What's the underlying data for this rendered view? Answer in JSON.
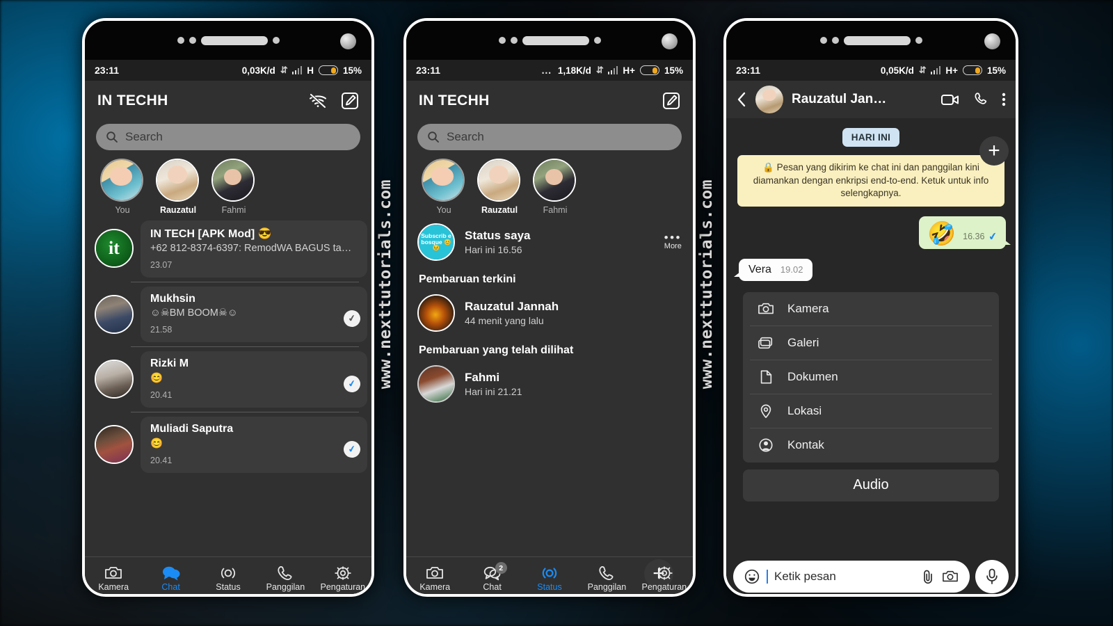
{
  "watermark": {
    "text": "www.nexttutorials.com"
  },
  "phone1": {
    "statusbar": {
      "time": "23:11",
      "speed": "0,03K/d",
      "network": "H",
      "battery": "15%"
    },
    "appbar": {
      "title": "IN TECHH",
      "wifi_icon": "wifi-off-icon",
      "compose_icon": "compose-icon"
    },
    "search": {
      "placeholder": "Search",
      "icon": "search-icon"
    },
    "stories": [
      {
        "label": "You",
        "state": "seen"
      },
      {
        "label": "Rauzatul",
        "state": "active"
      },
      {
        "label": "Fahmi",
        "state": "unseen"
      }
    ],
    "chats": [
      {
        "name": "IN TECH [APK Mod] 😎",
        "message": "+62 812-8374-6397: RemodWA BAGUS  ta…",
        "time": "23.07",
        "tick": "none"
      },
      {
        "name": "Mukhsin",
        "message": "☺☠BM BOOM☠☺",
        "time": "21.58",
        "tick": "grey"
      },
      {
        "name": "Rizki M",
        "message": "😊",
        "time": "20.41",
        "tick": "blue"
      },
      {
        "name": "Muliadi Saputra",
        "message": "😊",
        "time": "20.41",
        "tick": "blue"
      }
    ],
    "nav": [
      {
        "label": "Kamera",
        "icon": "camera-icon",
        "active": false
      },
      {
        "label": "Chat",
        "icon": "chat-icon",
        "active": true
      },
      {
        "label": "Status",
        "icon": "status-icon",
        "active": false
      },
      {
        "label": "Panggilan",
        "icon": "phone-icon",
        "active": false
      },
      {
        "label": "Pengaturan",
        "icon": "gear-icon",
        "active": false
      }
    ]
  },
  "phone2": {
    "statusbar": {
      "time": "23:11",
      "dots": "…",
      "speed": "1,18K/d",
      "network": "H+",
      "battery": "15%"
    },
    "appbar": {
      "title": "IN TECHH",
      "compose_icon": "compose-icon"
    },
    "search": {
      "placeholder": "Search",
      "icon": "search-icon"
    },
    "stories": [
      {
        "label": "You",
        "state": "seen"
      },
      {
        "label": "Rauzatul",
        "state": "active"
      },
      {
        "label": "Fahmi",
        "state": "unseen"
      }
    ],
    "my_status": {
      "avatar_text": "Subscrib e bosque 😊😣",
      "title": "Status saya",
      "subtitle": "Hari ini 16.56",
      "more_label": "More"
    },
    "sections": [
      {
        "heading": "Pembaruan terkini",
        "items": [
          {
            "name": "Rauzatul Jannah",
            "time": "44 menit yang lalu"
          }
        ]
      },
      {
        "heading": "Pembaruan yang telah dilihat",
        "items": [
          {
            "name": "Fahmi",
            "time": "Hari ini 21.21"
          }
        ]
      }
    ],
    "fab": {
      "icon": "plus-icon",
      "label": "+"
    },
    "nav": [
      {
        "label": "Kamera",
        "icon": "camera-icon",
        "active": false,
        "badge": ""
      },
      {
        "label": "Chat",
        "icon": "chat-outline-icon",
        "active": false,
        "badge": "2"
      },
      {
        "label": "Status",
        "icon": "status-icon",
        "active": true,
        "badge": ""
      },
      {
        "label": "Panggilan",
        "icon": "phone-icon",
        "active": false,
        "badge": ""
      },
      {
        "label": "Pengaturan",
        "icon": "gear-icon",
        "active": false,
        "badge": ""
      }
    ]
  },
  "phone3": {
    "statusbar": {
      "time": "23:11",
      "speed": "0,05K/d",
      "network": "H+",
      "battery": "15%"
    },
    "convbar": {
      "back_icon": "back-arrow-icon",
      "name": "Rauzatul Jan…",
      "video_icon": "video-call-icon",
      "call_icon": "phone-call-icon",
      "menu_icon": "overflow-menu-icon"
    },
    "day_pill": "HARI INI",
    "encryption_note": "🔒 Pesan yang dikirim ke chat ini dan panggilan kini diamankan dengan enkripsi end-to-end. Ketuk untuk info selengkapnya.",
    "messages": [
      {
        "side": "out",
        "emoji": "🤣",
        "time": "16.36",
        "tick": "blue"
      },
      {
        "side": "in",
        "text": "Vera",
        "time": "19.02"
      }
    ],
    "plus_fab": "+",
    "attachments": [
      {
        "label": "Kamera",
        "icon": "camera-icon"
      },
      {
        "label": "Galeri",
        "icon": "gallery-icon"
      },
      {
        "label": "Dokumen",
        "icon": "document-icon"
      },
      {
        "label": "Lokasi",
        "icon": "location-pin-icon"
      },
      {
        "label": "Kontak",
        "icon": "contact-icon"
      }
    ],
    "audio_button": "Audio",
    "composer": {
      "emoji_icon": "emoji-icon",
      "placeholder": "Ketik pesan",
      "attach_icon": "paperclip-icon",
      "camera_icon": "camera-icon",
      "mic_icon": "microphone-icon"
    }
  },
  "colors": {
    "accent_blue": "#1b8cf5",
    "app_bg": "#303030",
    "conv_bg": "#272727",
    "bubble_out": "#ddf2c8",
    "bubble_in": "#fdfdfd",
    "encryption_bg": "#faf0bf",
    "day_pill_bg": "#cfe3f2",
    "battery_fill": "#f0a921"
  }
}
